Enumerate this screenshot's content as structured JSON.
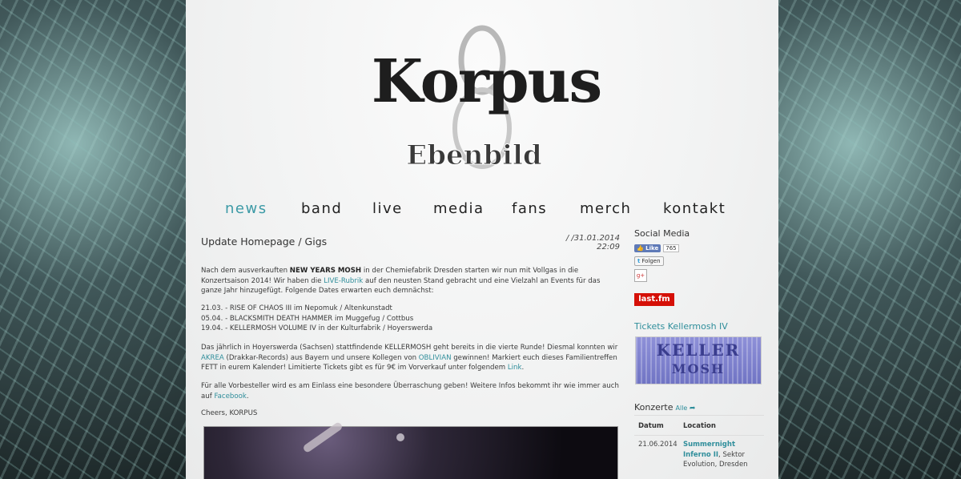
{
  "nav": [
    "news",
    "band",
    "live",
    "media",
    "fans",
    "merch",
    "kontakt"
  ],
  "logo": {
    "main": "Korpus",
    "sub": "Ebenbild"
  },
  "post": {
    "title": "Update Homepage / Gigs",
    "date": "/ /31.01.2014 22:09",
    "p1": {
      "t1": "Nach dem ausverkauften ",
      "bold": "NEW YEARS MOSH",
      "t2": " in der Chemiefabrik Dresden starten wir nun mit Vollgas in die Konzertsaison 2014! Wir haben die ",
      "link": "LIVE-Rubrik",
      "t3": " auf den neusten Stand gebracht und eine Vielzahl an Events für das ganze Jahr hinzugefügt. Folgende Dates erwarten euch demnächst:"
    },
    "dates": [
      "21.03. - RISE OF CHAOS III im Nepomuk / Altenkunstadt",
      "05.04. - BLACKSMITH DEATH HAMMER im Muggefug / Cottbus",
      "19.04. - KELLERMOSH VOLUME IV in der Kulturfabrik / Hoyerswerda"
    ],
    "p2": {
      "t1": "Das jährlich in Hoyerswerda (Sachsen) stattfindende KELLERMOSH geht bereits in die vierte Runde! Diesmal konnten wir ",
      "link1": "AKREA",
      "t2": " (Drakkar-Records) aus Bayern und unsere Kollegen von ",
      "link2": "OBLIVIAN",
      "t3": " gewinnen! Markiert euch dieses Familientreffen FETT in eurem Kalender! Limitierte Tickets gibt es für 9€ im Vorverkauf unter folgendem ",
      "link3": "Link",
      "t4": "."
    },
    "p3": {
      "t1": "Für alle Vorbesteller wird es am Einlass eine besondere Überraschung geben! Weitere Infos bekommt ihr wie immer auch auf ",
      "link": "Facebook",
      "t2": "."
    },
    "signoff": "Cheers, KORPUS"
  },
  "sidebar": {
    "social_title": "Social Media",
    "fb_like": "Like",
    "fb_count": "765",
    "tw_follow": "Folgen",
    "gplus": "g+",
    "lastfm": "last.fm",
    "tickets_title": "Tickets Kellermosh IV",
    "ticket_line1": "KELLER",
    "ticket_line2": "MOSH",
    "konzerte_title": "Konzerte",
    "konzerte_all": "Alle",
    "table_headers": [
      "Datum",
      "Location"
    ],
    "rows": [
      {
        "date": "21.06.2014",
        "event": "Summernight Inferno II",
        "place": ", Sektor Evolution, Dresden"
      }
    ]
  }
}
